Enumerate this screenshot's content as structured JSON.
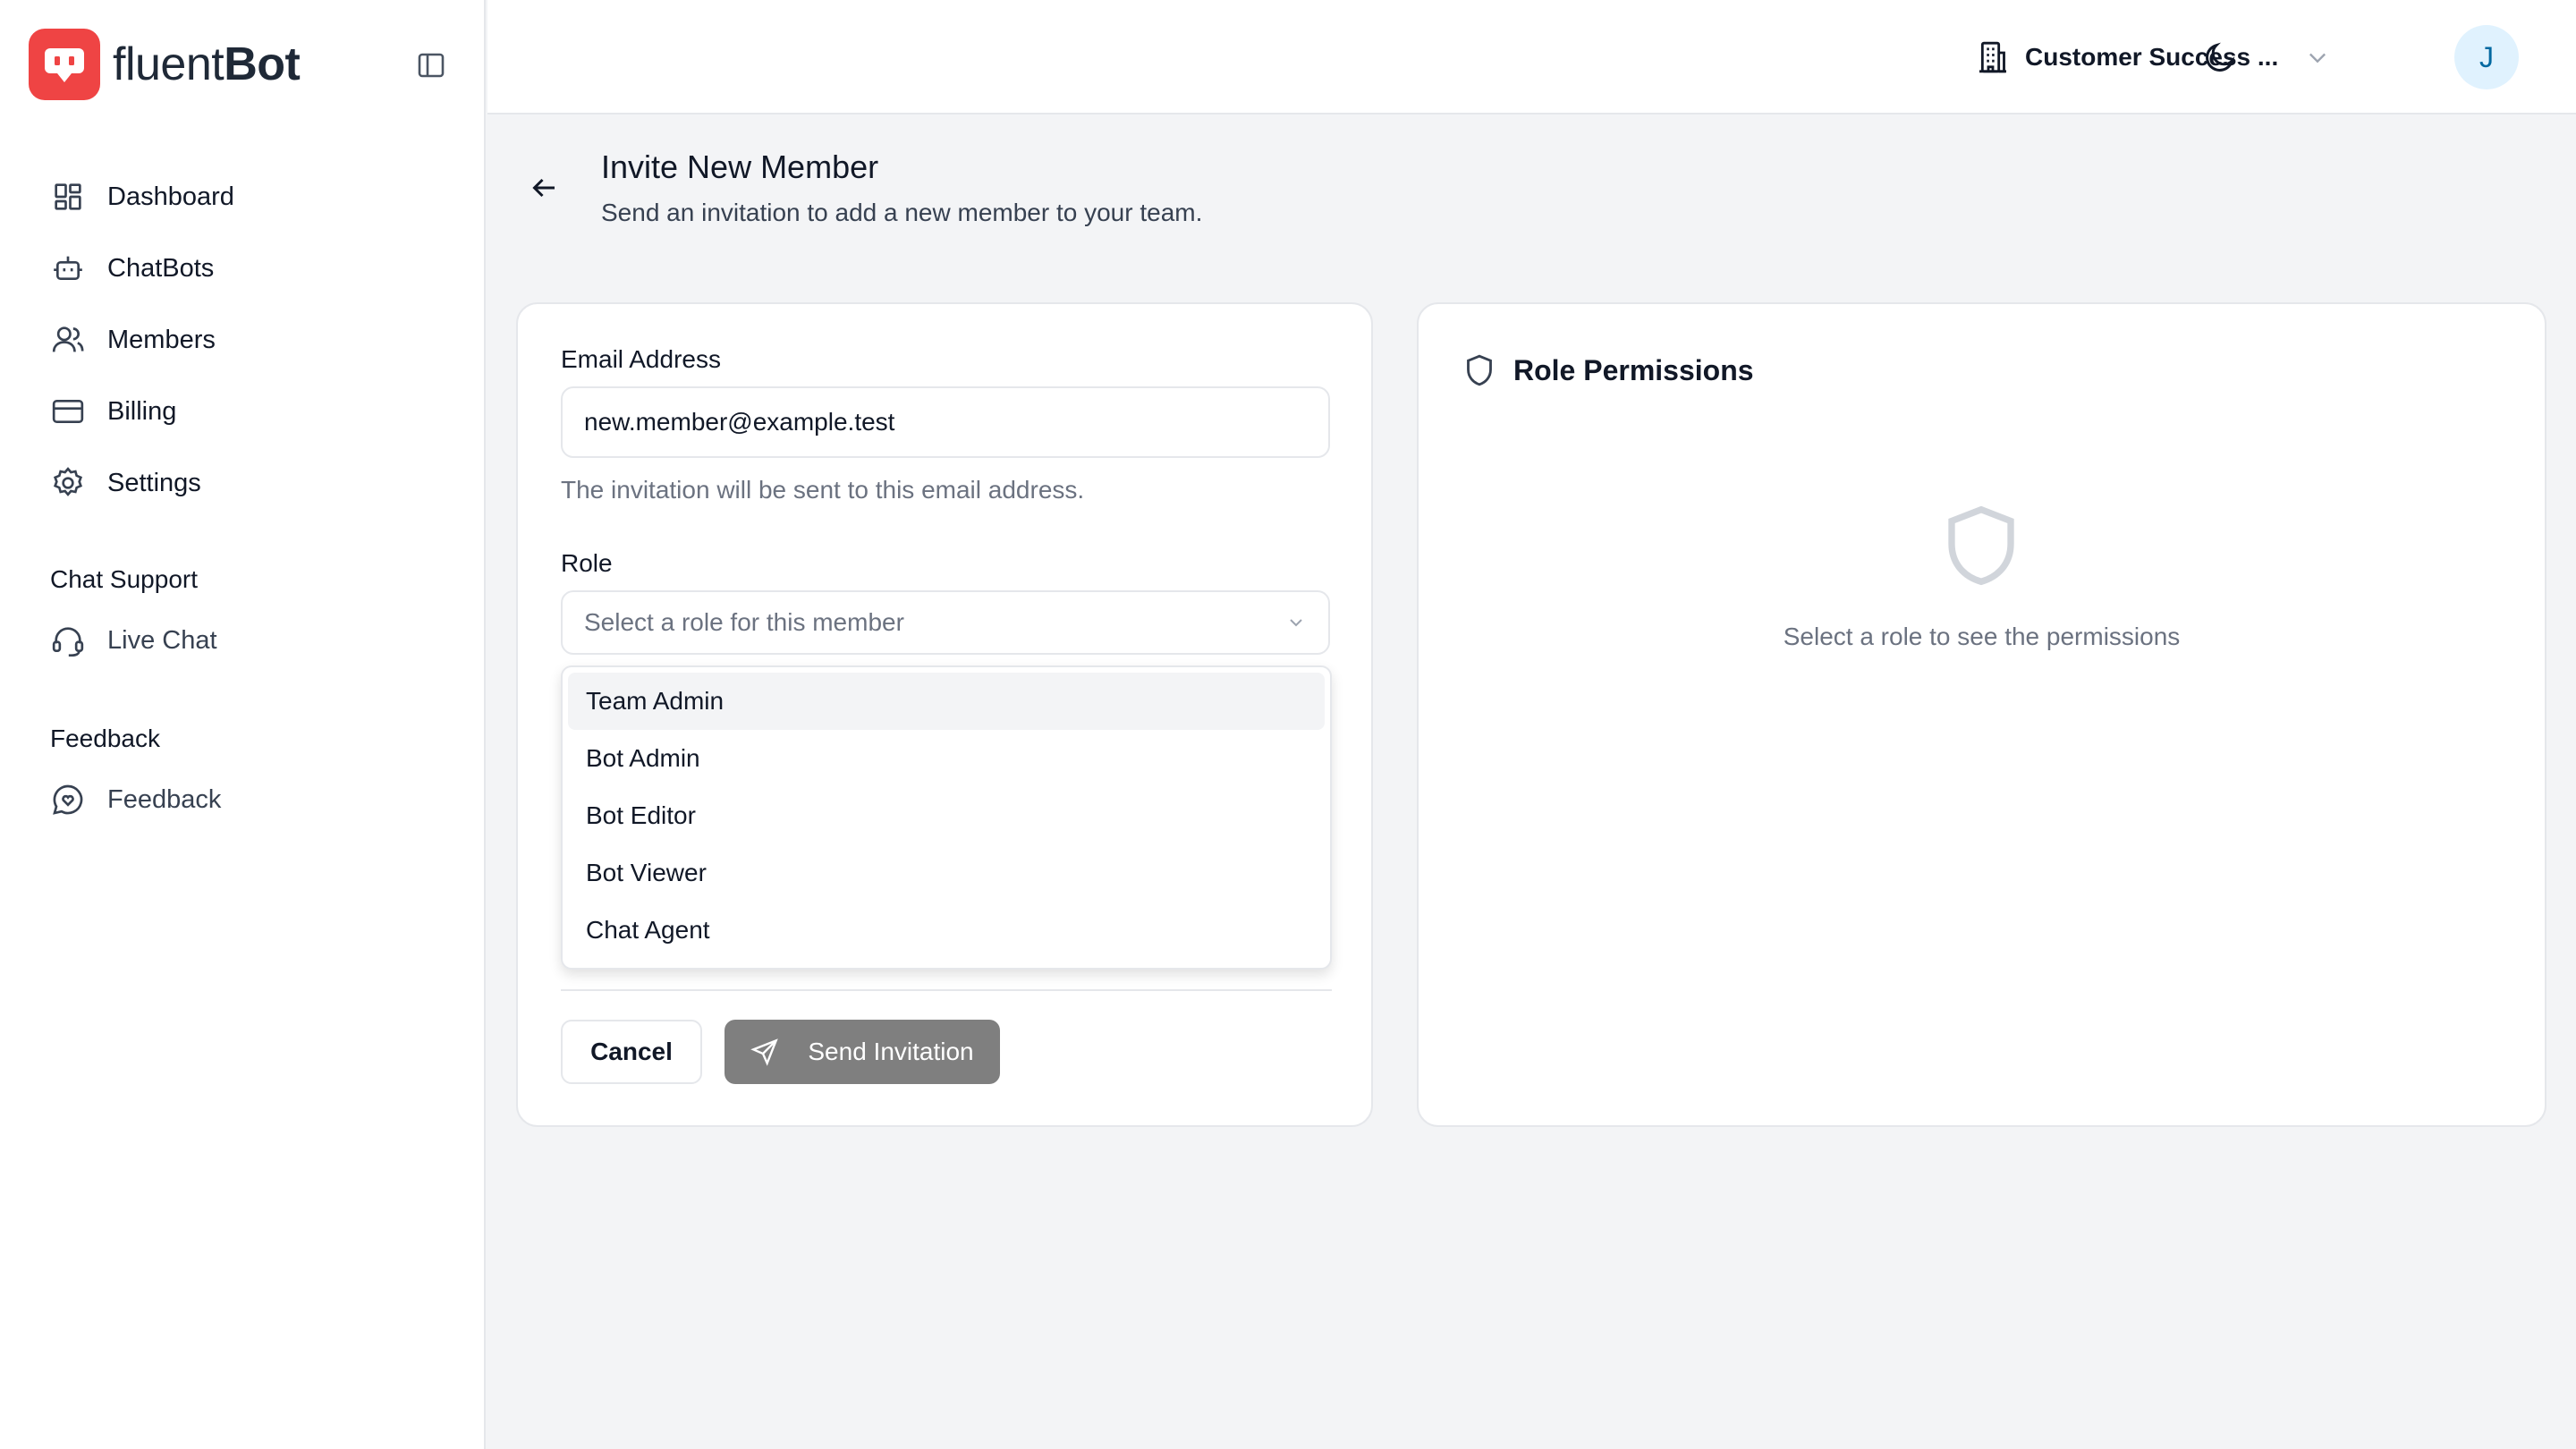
{
  "brand": {
    "name_light": "fluent",
    "name_bold": "Bot",
    "color": "#ef4444"
  },
  "sidebar": {
    "main_items": [
      {
        "label": "Dashboard",
        "icon": "dashboard-icon"
      },
      {
        "label": "ChatBots",
        "icon": "bot-icon"
      },
      {
        "label": "Members",
        "icon": "users-icon"
      },
      {
        "label": "Billing",
        "icon": "credit-card-icon"
      },
      {
        "label": "Settings",
        "icon": "gear-icon"
      }
    ],
    "sections": [
      {
        "title": "Chat Support",
        "items": [
          {
            "label": "Live Chat",
            "icon": "headset-icon"
          }
        ]
      },
      {
        "title": "Feedback",
        "items": [
          {
            "label": "Feedback",
            "icon": "message-heart-icon"
          }
        ]
      }
    ]
  },
  "header": {
    "team_name": "Customer Success ...",
    "avatar_initial": "J"
  },
  "page": {
    "title": "Invite New Member",
    "subtitle": "Send an invitation to add a new member to your team."
  },
  "form": {
    "email_label": "Email Address",
    "email_value": "new.member@example.test",
    "email_hint": "The invitation will be sent to this email address.",
    "role_label": "Role",
    "role_placeholder": "Select a role for this member",
    "role_options": [
      "Team Admin",
      "Bot Admin",
      "Bot Editor",
      "Bot Viewer",
      "Chat Agent"
    ],
    "highlighted_option": "Team Admin",
    "cancel_label": "Cancel",
    "send_label": "Send Invitation"
  },
  "permissions": {
    "title": "Role Permissions",
    "empty_text": "Select a role to see the permissions"
  },
  "colors": {
    "accent": "#ef4444",
    "avatar_bg": "#e0f2fe",
    "avatar_text": "#0369a1",
    "send_button_bg": "#7f7f7f"
  }
}
